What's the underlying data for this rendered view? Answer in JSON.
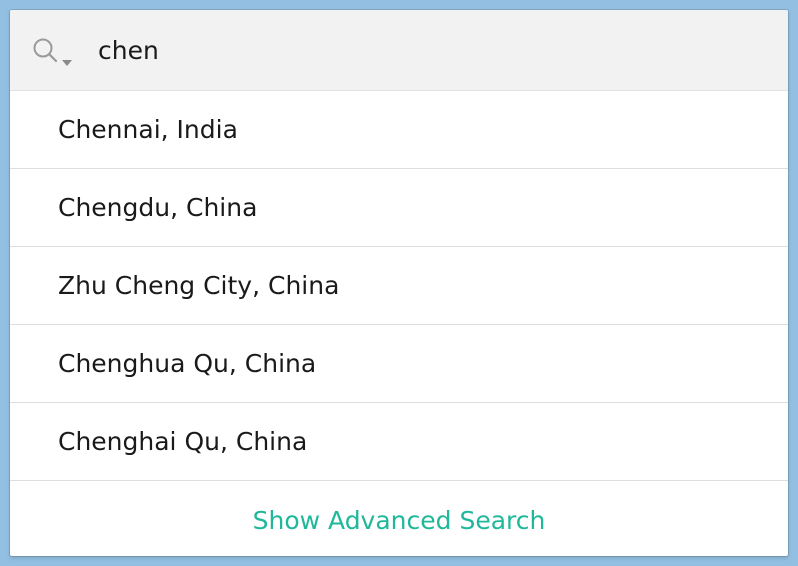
{
  "search": {
    "value": "chen",
    "icon": "search-icon",
    "dropdown_icon": "caret-down-icon",
    "icon_color": "#9a9a9a"
  },
  "results": [
    {
      "label": "Chennai, India"
    },
    {
      "label": "Chengdu, China"
    },
    {
      "label": "Zhu Cheng City, China"
    },
    {
      "label": "Chenghua Qu, China"
    },
    {
      "label": "Chenghai Qu, China"
    }
  ],
  "footer": {
    "advanced_label": "Show Advanced Search",
    "accent_color": "#1fb89a"
  },
  "colors": {
    "background": "#93bfe2",
    "search_bar_bg": "#f2f2f2",
    "divider": "#dedede"
  }
}
